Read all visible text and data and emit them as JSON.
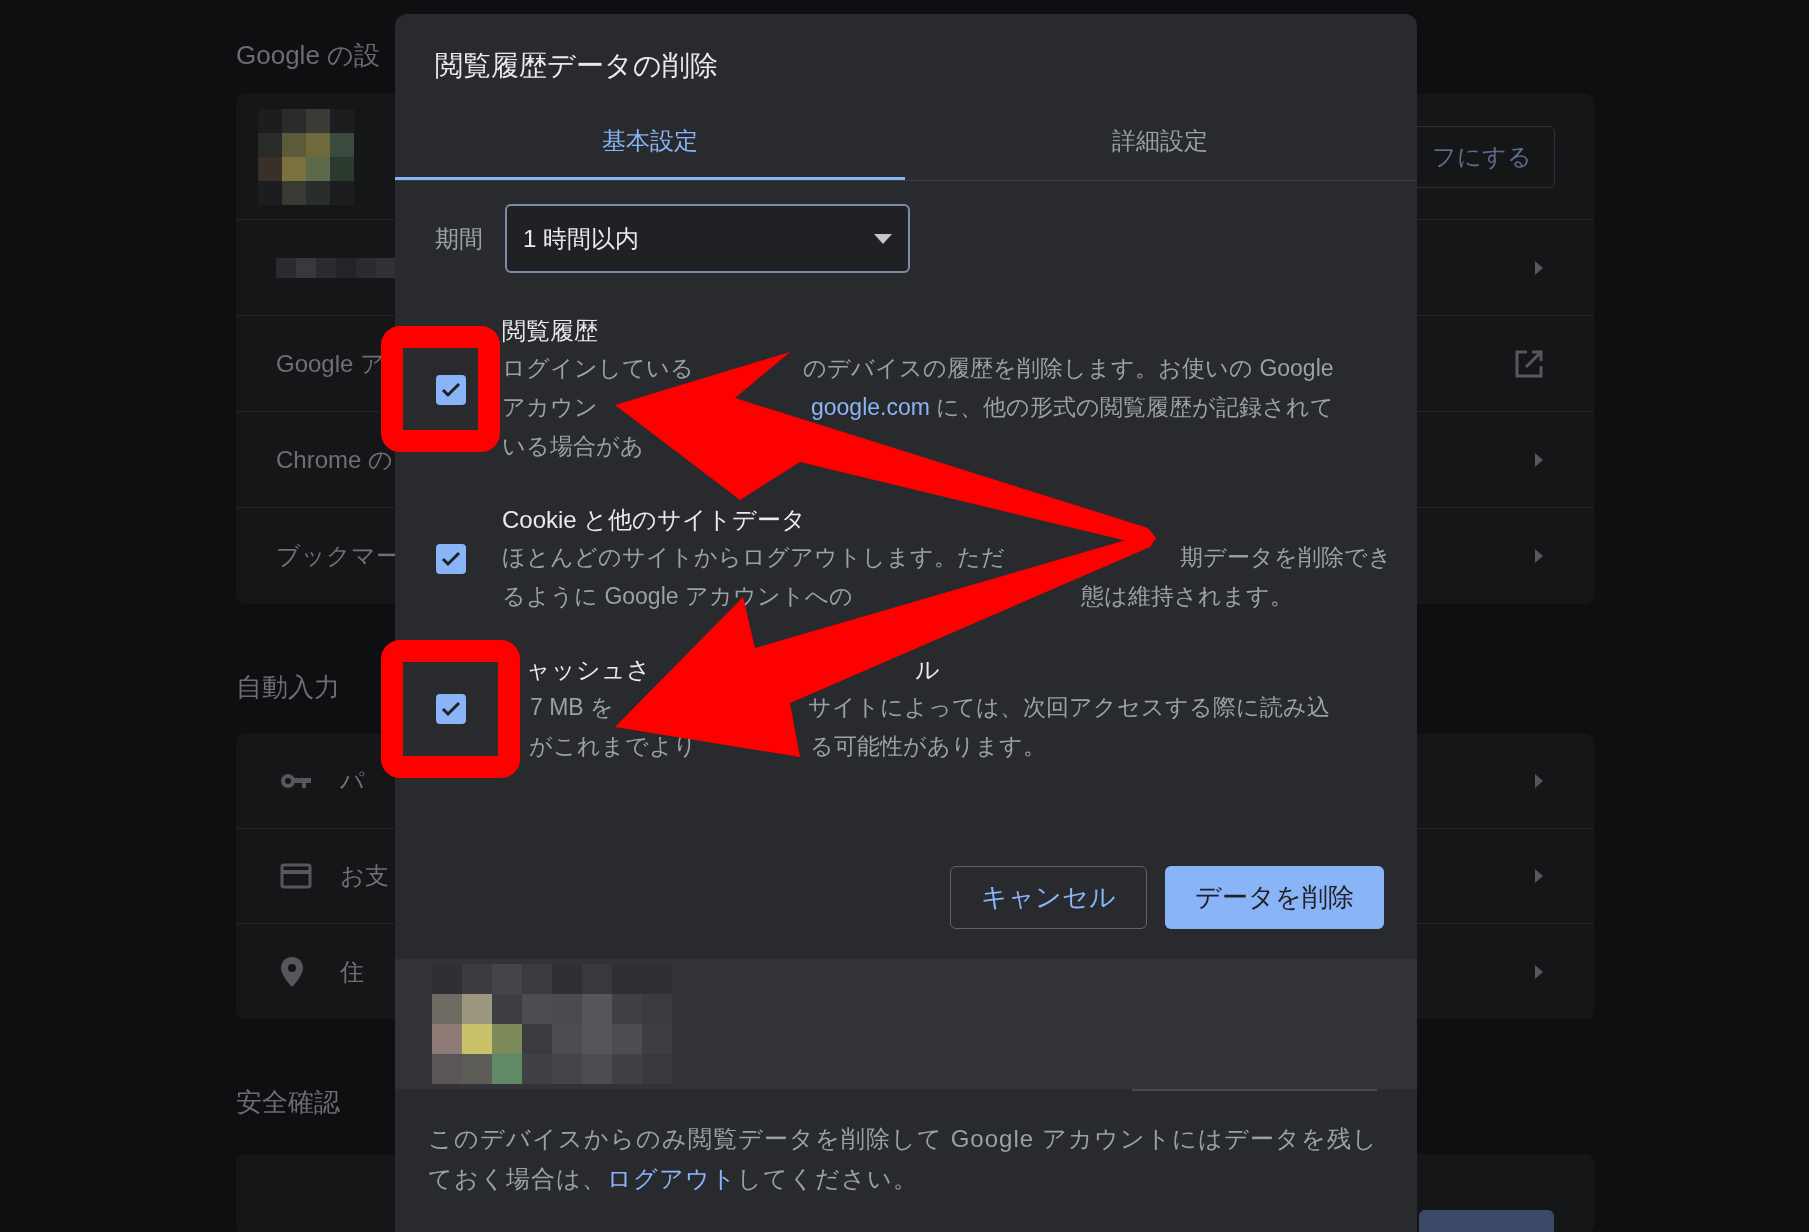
{
  "settings_page": {
    "section_title": "Google の設",
    "account_button": "フにする",
    "rows": [
      {
        "kind": "arrow"
      },
      {
        "label": "Google ア",
        "kind": "external"
      },
      {
        "label": "Chrome の",
        "kind": "arrow"
      },
      {
        "label": "ブックマー",
        "kind": "arrow"
      }
    ],
    "autofill": {
      "title": "自動入力",
      "rows": [
        {
          "kind": "key",
          "label": "パ"
        },
        {
          "kind": "card",
          "label": "お支"
        },
        {
          "kind": "pin",
          "label": "住"
        }
      ]
    },
    "safety": {
      "title": "安全確認"
    }
  },
  "dialog": {
    "title": "閲覧履歴データの削除",
    "tabs": [
      {
        "label": "基本設定",
        "selected": true
      },
      {
        "label": "詳細設定",
        "selected": false
      }
    ],
    "period": {
      "label": "期間",
      "value": "1 時間以内"
    },
    "items": [
      {
        "checked": true,
        "title": [
          {
            "text": "閲覧履歴"
          }
        ],
        "lines": [
          [
            {
              "kind": "text",
              "text": "ログインしている"
            },
            {
              "kind": "text",
              "text": "のデバイスの履歴を削除します。お使いの Google"
            }
          ],
          [
            {
              "kind": "text",
              "text": "アカウン"
            },
            {
              "kind": "link",
              "text": "google.com"
            },
            {
              "kind": "text",
              "text": " に、他の形式の閲覧履歴が記録されて"
            }
          ],
          [
            {
              "kind": "text",
              "text": "いる場合があ"
            }
          ]
        ]
      },
      {
        "checked": true,
        "title": [
          {
            "text": "Cookie と他のサイトデータ"
          }
        ],
        "lines": [
          [
            {
              "kind": "text",
              "text": "ほとんどのサイトからログアウトします。ただ"
            },
            {
              "kind": "text",
              "text": "期データを削除でき"
            }
          ],
          [
            {
              "kind": "text",
              "text": "るように Google アカウントへの"
            },
            {
              "kind": "text",
              "text": "態は維持されます。"
            }
          ]
        ]
      },
      {
        "checked": true,
        "title": [
          {
            "text": "ャッシュさ"
          },
          {
            "text": "ル"
          }
        ],
        "lines": [
          [
            {
              "kind": "text",
              "text": "7 MB を"
            },
            {
              "kind": "text",
              "text": "サイトによっては、次回アクセスする際に読み込"
            }
          ],
          [
            {
              "kind": "text",
              "text": "がこれまでより"
            },
            {
              "kind": "text",
              "text": "る可能性があります。"
            }
          ]
        ]
      }
    ],
    "buttons": [
      {
        "label": "キャンセル",
        "kind": "outline"
      },
      {
        "label": "データを削除",
        "kind": "primary"
      }
    ],
    "footer": {
      "text_before": "このデバイスからのみ閲覧データを削除して Google アカウントにはデータを残しておく場合は、",
      "link": "ログアウト",
      "text_after": "してください。"
    }
  }
}
